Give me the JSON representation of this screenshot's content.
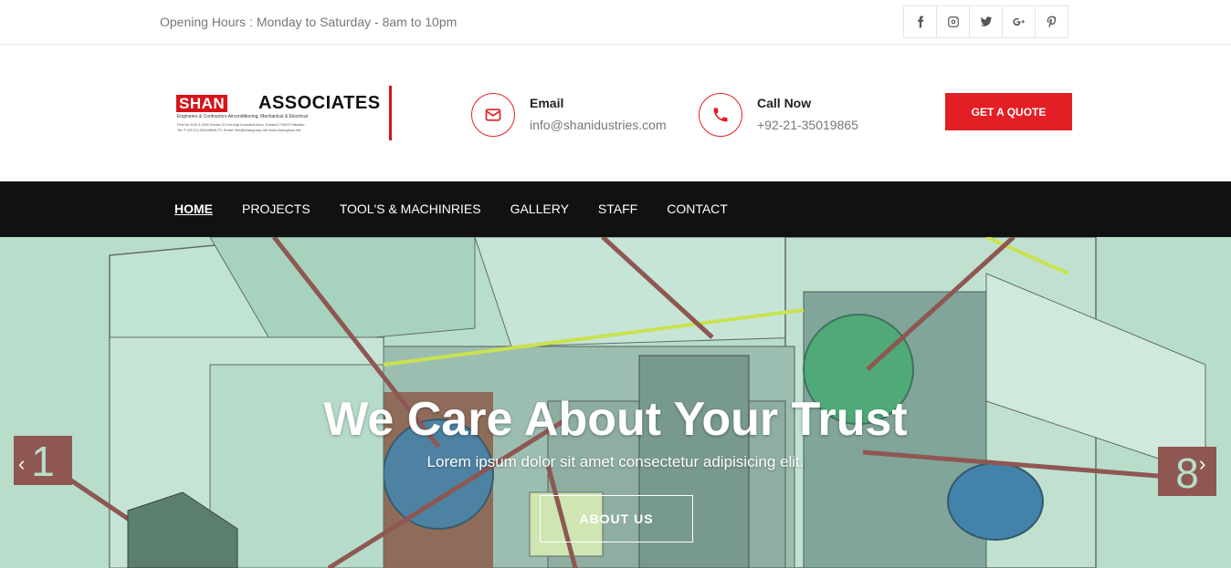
{
  "topbar": {
    "hours": "Opening Hours : Monday to Saturday - 8am to 10pm",
    "social": [
      {
        "icon": "facebook-icon",
        "glyph": "f"
      },
      {
        "icon": "instagram-icon",
        "glyph": ""
      },
      {
        "icon": "twitter-icon",
        "glyph": ""
      },
      {
        "icon": "google-plus-icon",
        "glyph": "G+"
      },
      {
        "icon": "pinterest-icon",
        "glyph": ""
      }
    ]
  },
  "logo": {
    "shan": "SHAN",
    "associates": "ASSOCIATES",
    "tagline": "Engineers & Contractors Airconditioning, Mechanical & Electrical",
    "address": "Plot No 3/29 & 3/55 Sector-21 Korangi Industrial Area, Karachi-74900 Pakistan",
    "contact_line": "Tel: P (92-21) 35019865-73, Email: info@shangroup.net    www.shangroup.net"
  },
  "contact": {
    "email_label": "Email",
    "email_value": "info@shanidustries.com",
    "call_label": "Call Now",
    "call_value": "+92-21-35019865"
  },
  "quote_button": "GET A QUOTE",
  "nav": {
    "items": [
      "HOME",
      "PROJECTS",
      "TOOL'S & MACHINRIES",
      "GALLERY",
      "STAFF",
      "CONTACT"
    ]
  },
  "hero": {
    "title": "We Care About Your Trust",
    "subtitle": "Lorem ipsum dolor sit amet consectetur adipisicing elit.",
    "button": "ABOUT US",
    "label_left": "1",
    "label_right": "8",
    "prev": "‹",
    "next": "›"
  },
  "colors": {
    "accent": "#e31e24",
    "nav_bg": "#111111",
    "hero_bg": "#b9dccb"
  }
}
